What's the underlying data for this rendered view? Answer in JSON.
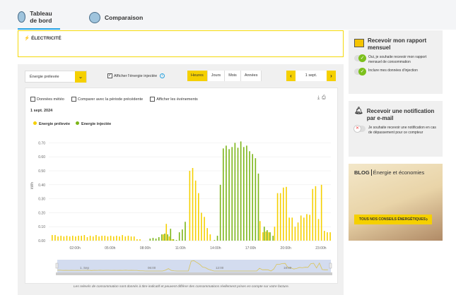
{
  "tabs": [
    {
      "label": "Tableau de bord",
      "active": true
    },
    {
      "label": "Comparaison",
      "active": false
    }
  ],
  "section_title": "ÉLECTRICITÉ",
  "controls": {
    "energy_select": "Énergie prélevée",
    "show_injected_label": "Afficher l'énergie injectée",
    "show_injected_checked": true,
    "periods": [
      "Heures",
      "Jours",
      "Mois",
      "Années"
    ],
    "active_period": "Heures",
    "date": "1 sept.",
    "prev": "‹",
    "next": "›"
  },
  "options": [
    {
      "label": "Données météo",
      "checked": false
    },
    {
      "label": "Comparer avec la période précédente",
      "checked": false
    },
    {
      "label": "Afficher les événements",
      "checked": false
    }
  ],
  "chart_date": "1 sept. 2024",
  "colors": {
    "accent": "#f5d000",
    "prelevee": "#f5d000",
    "injectee": "#7cb518"
  },
  "chart_data": {
    "type": "bar",
    "ylabel": "kWh",
    "ylim": [
      0,
      0.75
    ],
    "yticks": [
      "0.00",
      "0.10",
      "0.20",
      "0.30",
      "0.40",
      "0.50",
      "0.60",
      "0.70"
    ],
    "xticks": [
      "02:00h",
      "05:00h",
      "08:00h",
      "11:00h",
      "14:00h",
      "17:00h",
      "20:00h",
      "23:00h"
    ],
    "x_interval": "15 min",
    "series": [
      {
        "name": "Energie prélevée",
        "values": [
          0.04,
          0.04,
          0.03,
          0.035,
          0.03,
          0.035,
          0.03,
          0.035,
          0.03,
          0.035,
          0.035,
          0.04,
          0.025,
          0.035,
          0.03,
          0.04,
          0.03,
          0.035,
          0.035,
          0.03,
          0.035,
          0.03,
          0.035,
          0.03,
          0.04,
          0.03,
          0.035,
          0.03,
          0.03,
          0.01,
          0.01,
          0,
          0,
          0,
          0,
          0,
          0,
          0,
          0.045,
          0.12,
          0.03,
          0.01,
          0,
          0,
          0,
          0,
          0,
          0.5,
          0.52,
          0.43,
          0.34,
          0.2,
          0.17,
          0.09,
          0.045,
          0,
          0,
          0,
          0,
          0,
          0,
          0,
          0,
          0,
          0,
          0,
          0,
          0,
          0,
          0,
          0,
          0.14,
          0.06,
          0.065,
          0.06,
          0,
          0.1,
          0.34,
          0.34,
          0.38,
          0.385,
          0.165,
          0.165,
          0.1,
          0.13,
          0.18,
          0.165,
          0.19,
          0.185,
          0.37,
          0.39,
          0.155,
          0.4,
          0.07,
          0.06,
          0.06
        ]
      },
      {
        "name": "Energie injectée",
        "values": [
          0,
          0,
          0,
          0,
          0,
          0,
          0,
          0,
          0,
          0,
          0,
          0,
          0,
          0,
          0,
          0,
          0,
          0,
          0,
          0,
          0,
          0,
          0,
          0,
          0,
          0,
          0,
          0,
          0,
          0,
          0,
          0,
          0,
          0.015,
          0.02,
          0.015,
          0.025,
          0.045,
          0.05,
          0.045,
          0.085,
          0.01,
          0.005,
          0.06,
          0.08,
          0.135,
          0,
          0,
          0,
          0,
          0,
          0,
          0,
          0,
          0,
          0.005,
          0.035,
          0.4,
          0.66,
          0.68,
          0.655,
          0.67,
          0.7,
          0.665,
          0.71,
          0.67,
          0.68,
          0.64,
          0.62,
          0.59,
          0.48,
          0,
          0.1,
          0.075,
          0.06,
          0.035,
          0,
          0,
          0,
          0,
          0,
          0,
          0,
          0,
          0,
          0,
          0,
          0,
          0,
          0,
          0,
          0,
          0,
          0,
          0,
          0
        ]
      }
    ],
    "navigator_labels": [
      "1. Sep",
      "06:00",
      "12:00",
      "18:00"
    ]
  },
  "footnote": "Les relevés de consommation sont donnés à titre indicatif et peuvent différer des consommations réellement prises en compte sur votre facture.",
  "monthly_report": {
    "title": "Recevoir mon rapport mensuel",
    "items": [
      {
        "label": "Oui, je souhaite recevoir mon rapport mensuel de consommation",
        "on": true
      },
      {
        "label": "Inclure mes données d'injection",
        "on": true
      }
    ]
  },
  "notification": {
    "title": "Recevoir une notification par e-mail",
    "items": [
      {
        "label": "Je souhaite recevoir une notification en cas de dépassement pour ce compteur",
        "on": false
      }
    ]
  },
  "blog": {
    "tag": "BLOG",
    "title": "Énergie et économies",
    "button": "TOUS NOS CONSEILS ÉNERGÉTIQUES",
    "button_icon": "›"
  }
}
